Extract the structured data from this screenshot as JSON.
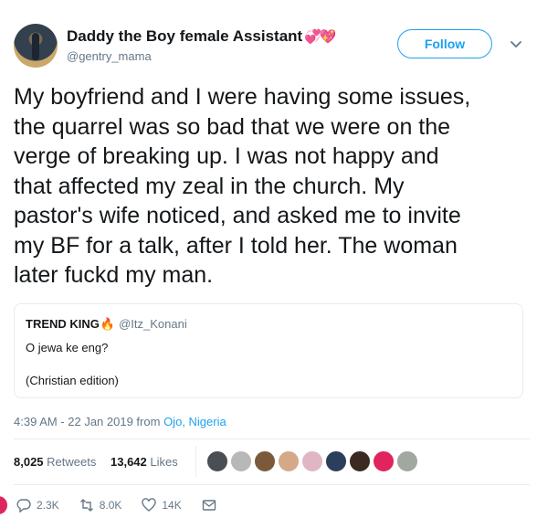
{
  "user": {
    "display_name": "Daddy the Boy female Assistant",
    "emoji": "💞💖",
    "handle": "@gentry_mama",
    "follow_label": "Follow"
  },
  "tweet": {
    "text": "My boyfriend and I were having some issues,\nthe quarrel was so bad that we were on the\nverge of breaking up. I was not happy and\nthat affected my zeal in the church. My\npastor's wife noticed, and asked me to invite\nmy BF for a talk, after I told her. The woman\nlater fuckd my man.",
    "timestamp": "4:39 AM - 22 Jan 2019 from",
    "location": "Ojo, Nigeria"
  },
  "quote": {
    "name": "TREND KING",
    "emoji": "🔥",
    "handle": "@Itz_Konani",
    "line1": "O jewa ke eng?",
    "line2": "(Christian edition)"
  },
  "stats": {
    "retweets_count": "8,025",
    "retweets_label": "Retweets",
    "likes_count": "13,642",
    "likes_label": "Likes"
  },
  "likers_colors": [
    "#4a4f55",
    "#b8b8b8",
    "#7b5a3c",
    "#d6a88a",
    "#e0b6c4",
    "#2b3f5c",
    "#3b2a22",
    "#e0245e",
    "#a0a8a0"
  ],
  "actions": {
    "replies": "2.3K",
    "retweets": "8.0K",
    "likes": "14K"
  },
  "colors": {
    "accent": "#1da1f2",
    "secondary_text": "#657786"
  }
}
